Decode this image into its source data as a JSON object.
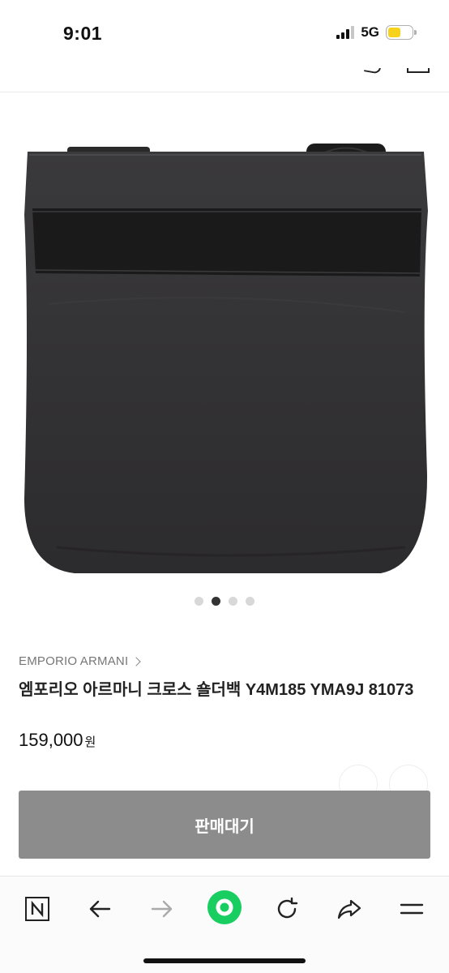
{
  "status_bar": {
    "time": "9:01",
    "network": "5G",
    "battery_color": "#f7d21b"
  },
  "product": {
    "image_count": 4,
    "active_image_index": 1,
    "brand": "EMPORIO ARMANI",
    "title": "엠포리오 아르마니 크로스 숄더백 Y4M185 YMA9J 81073",
    "price": "159,000",
    "price_unit": "원"
  },
  "actions": {
    "sell_button_label": "판매대기",
    "sell_button_color": "#8c8c8c"
  },
  "browser_bar": {
    "icons": [
      "naver-n-icon",
      "back-arrow-icon",
      "forward-arrow-icon",
      "green-home-icon",
      "refresh-icon",
      "share-icon",
      "menu-icon"
    ],
    "accent": "#19ce60"
  }
}
